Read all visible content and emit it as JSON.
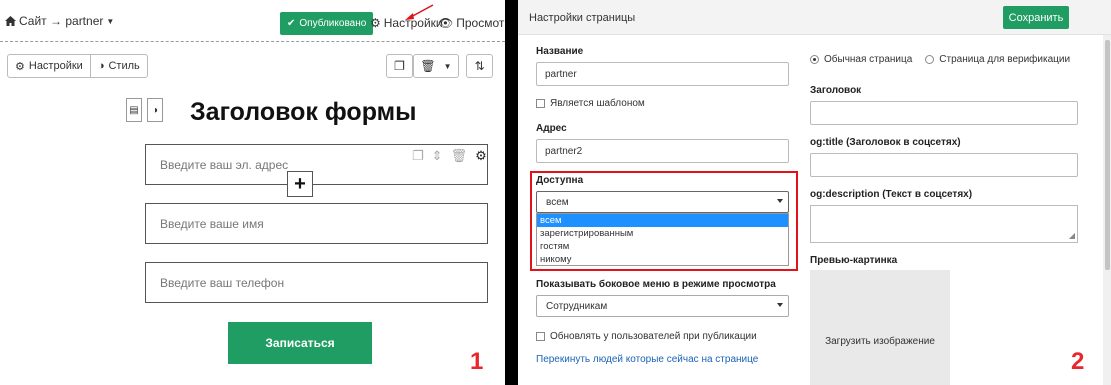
{
  "left": {
    "breadcrumb": "Сайт → partner",
    "published_label": "Опубликовано",
    "settings_link": "Настройки",
    "preview_link": "Просмотр",
    "tab_settings": "Настройки",
    "tab_style": "Стиль",
    "form_title": "Заголовок формы",
    "fields": [
      {
        "placeholder": "Введите ваш эл. адрес"
      },
      {
        "placeholder": "Введите ваше имя"
      },
      {
        "placeholder": "Введите ваш телефон"
      }
    ],
    "submit_label": "Записаться",
    "marker": "1"
  },
  "right": {
    "title": "Настройки страницы",
    "save_label": "Сохранить",
    "name_label": "Название",
    "name_value": "partner",
    "template_checkbox": "Является шаблоном",
    "address_label": "Адрес",
    "address_value": "partner2",
    "access_label": "Доступна",
    "access_value": "всем",
    "access_options": [
      "всем",
      "зарегистрированным",
      "гостям",
      "никому"
    ],
    "sidebar_label": "Показывать боковое меню в режиме просмотра",
    "sidebar_value": "Сотрудникам",
    "update_checkbox": "Обновлять у пользователей при публикации",
    "move_link": "Перекинуть людей которые сейчас на странице",
    "page_type_regular": "Обычная страница",
    "page_type_verify": "Страница для верификации",
    "heading_label": "Заголовок",
    "og_title_label": "og:title (Заголовок в соцсетях)",
    "og_desc_label": "og:description (Текст в соцсетях)",
    "preview_label": "Превью-картинка",
    "upload_label": "Загрузить изображение",
    "marker": "2"
  },
  "colors": {
    "accent_green": "#1f9d62",
    "highlight_red": "#e0121a",
    "link_blue": "#1a64b5",
    "selected_blue": "#1e90ff"
  }
}
